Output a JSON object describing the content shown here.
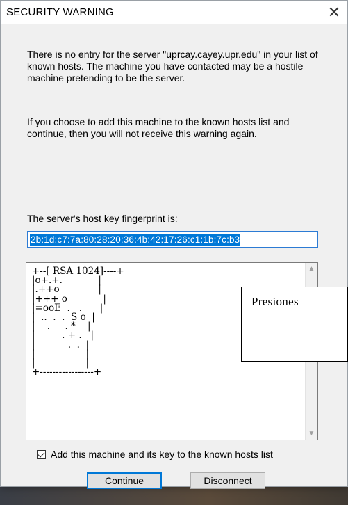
{
  "window": {
    "title": "SECURITY WARNING",
    "close_icon": "close-icon"
  },
  "message": {
    "paragraph1": "There is no entry for the server \"uprcay.cayey.upr.edu\" in your list of known hosts. The machine you have contacted may be a hostile machine pretending to be the server.",
    "paragraph2": "If you choose to add this machine to the known hosts list and continue, then you will not receive this warning again."
  },
  "fingerprint": {
    "label": "The server's host key fingerprint is:",
    "value": "2b:1d:c7:7a:80:28:20:36:4b:42:17:26:c1:1b:7c:b3"
  },
  "randomart": {
    "text": "+--[ RSA 1024]----+\n|o+.+.            |\n|.++o             |\n|+++ o            |\n|=ooE  .   .      |\n|  ..  .  .  S o  |\n|    .     . *    |\n|         . + .   |\n|           .  .  |\n|                 |\n|                 |\n+-----------------+",
    "scroll_up_icon": "scroll-up-arrow-icon",
    "scroll_down_icon": "scroll-down-arrow-icon"
  },
  "overlay": {
    "text": "Presiones"
  },
  "checkbox": {
    "label": "Add this machine and its key to the known hosts list",
    "checked": true
  },
  "buttons": {
    "continue": "Continue",
    "disconnect": "Disconnect"
  },
  "colors": {
    "accent": "#0078d7",
    "dialog_bg": "#f0f0f0"
  }
}
